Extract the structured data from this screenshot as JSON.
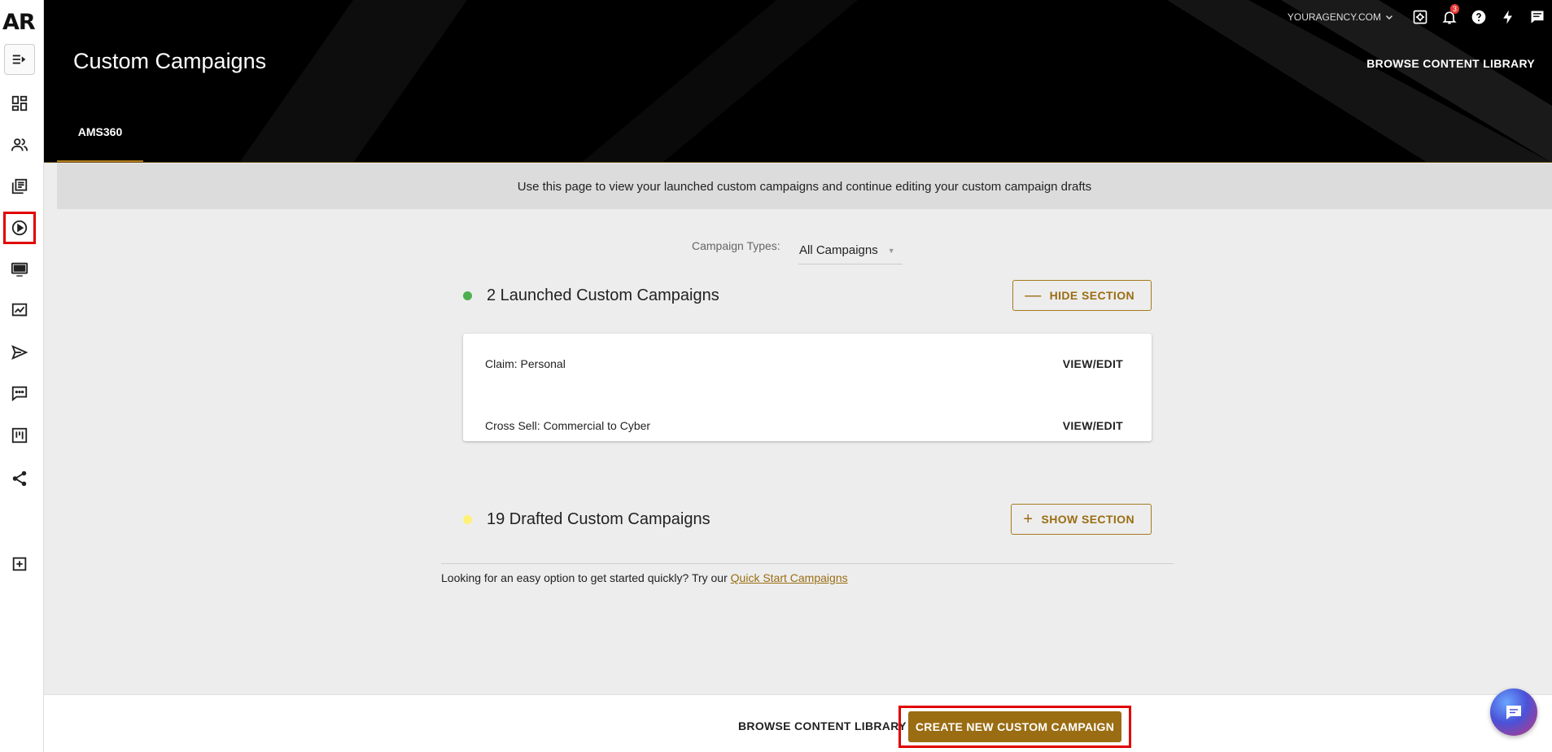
{
  "sidebar": {
    "logo": "AR",
    "items": [
      {
        "name": "menu-toggle",
        "icon": "menu-collapse-icon"
      },
      {
        "name": "dashboard",
        "icon": "dashboard-icon"
      },
      {
        "name": "contacts",
        "icon": "people-icon"
      },
      {
        "name": "content",
        "icon": "library-icon"
      },
      {
        "name": "campaigns",
        "icon": "play-circle-icon"
      },
      {
        "name": "website",
        "icon": "monitor-icon"
      },
      {
        "name": "reports",
        "icon": "chart-board-icon"
      },
      {
        "name": "send",
        "icon": "send-icon"
      },
      {
        "name": "messages",
        "icon": "chat-dots-icon"
      },
      {
        "name": "board",
        "icon": "kanban-icon"
      },
      {
        "name": "social",
        "icon": "share-icon"
      },
      {
        "name": "add",
        "icon": "add-box-icon"
      }
    ]
  },
  "header": {
    "title": "Custom Campaigns",
    "domain": "YOURAGENCY.COM",
    "notification_count": "3",
    "browse_label": "BROWSE CONTENT LIBRARY",
    "tabs": [
      {
        "label": "AMS360"
      }
    ]
  },
  "info_text": "Use this page to view your launched custom campaigns and continue editing your custom campaign drafts",
  "filter": {
    "label": "Campaign Types:",
    "value": "All Campaigns"
  },
  "launched": {
    "title": "2 Launched Custom Campaigns",
    "button": "HIDE SECTION",
    "dot_color": "#4caf50",
    "items": [
      {
        "name": "Claim: Personal",
        "action": "VIEW/EDIT"
      },
      {
        "name": "Cross Sell: Commercial to Cyber",
        "action": "VIEW/EDIT"
      }
    ]
  },
  "drafted": {
    "title": "19 Drafted Custom Campaigns",
    "button": "SHOW SECTION",
    "dot_color": "#fff176"
  },
  "quick_start": {
    "text": "Looking for an easy option to get started quickly? Try our",
    "link": "Quick Start Campaigns"
  },
  "footer": {
    "browse_label": "BROWSE CONTENT LIBRARY",
    "create_label": "CREATE NEW CUSTOM CAMPAIGN"
  },
  "colors": {
    "accent": "#9a6d13",
    "highlight": "#e00000"
  }
}
